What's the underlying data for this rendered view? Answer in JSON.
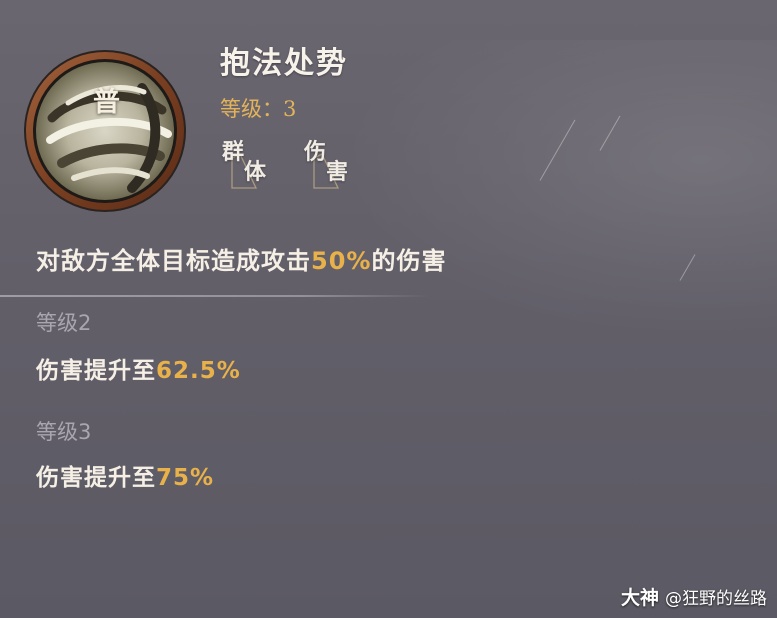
{
  "skill": {
    "grade": "普",
    "name": "抱法处势",
    "level_label": "等级：",
    "level_value": "3",
    "tags": [
      {
        "c1": "群",
        "c2": "体"
      },
      {
        "c1": "伤",
        "c2": "害"
      }
    ],
    "icon": "swirl-skill-icon"
  },
  "description": {
    "pre": "对敌方全体目标造成攻击",
    "value": "50%",
    "post": "的伤害"
  },
  "upgrades": [
    {
      "title": "等级2",
      "effect_pre": "伤害提升至",
      "effect_value": "62.5%"
    },
    {
      "title": "等级3",
      "effect_pre": "伤害提升至",
      "effect_value": "75%"
    }
  ],
  "watermark": {
    "logo": "大神",
    "handle": "@狂野的丝路"
  },
  "colors": {
    "background": "#625f69",
    "highlight": "#e9b14a",
    "level_gold": "#e3b35a",
    "muted_header": "#aaa6b0"
  }
}
